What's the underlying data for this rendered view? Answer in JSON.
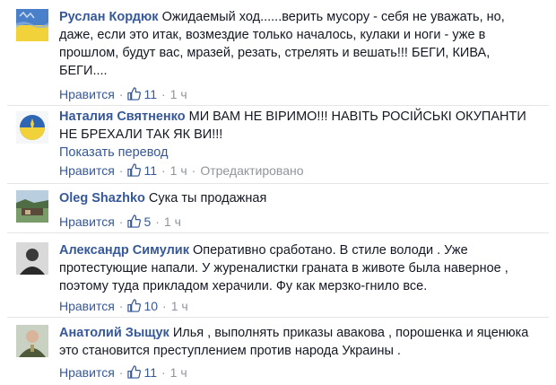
{
  "comments": [
    {
      "author": "Руслан Кордюк",
      "text": "Ожидаемый ход......верить мусору - себя не уважать, но, даже, если это итак, возмездие только началось, кулаки и ноги - уже в прошлом, будут вас, мразей, резать, стрелять и вешать!!! БЕГИ, КИВА, БЕГИ....",
      "like_label": "Нравится",
      "likes": "11",
      "time": "1 ч",
      "avatar": "ukraine-flag-avatar"
    },
    {
      "author": "Наталия Святненко",
      "text": "МИ ВАМ НЕ ВІРИМО!!! НАВІТЬ РОСІЙСЬКІ ОКУПАНТИ НЕ БРЕХАЛИ ТАК ЯК ВИ!!!",
      "translate": "Показать перевод",
      "like_label": "Нравится",
      "likes": "11",
      "time": "1 ч",
      "edited": "Отредактировано",
      "avatar": "ukraine-emblem-avatar"
    },
    {
      "author": "Oleg Shazhko",
      "text": "Сука ты продажная",
      "like_label": "Нравится",
      "likes": "5",
      "time": "1 ч",
      "avatar": "landscape-avatar"
    },
    {
      "author": "Александр Симулик",
      "text": "Оперативно сработано. В стиле володи . Уже протестующие напали. У журеналистки граната в животе была наверное , поэтому туда прикладом херачили. Фу как мерзко-гнило все.",
      "like_label": "Нравится",
      "likes": "10",
      "time": "1 ч",
      "avatar": "person-avatar"
    },
    {
      "author": "Анатолий Зыщук",
      "text": "Илья , выполнять приказы авакова , порошенка и яценюка это становится преступлением против народа Украины .",
      "like_label": "Нравится",
      "likes": "11",
      "time": "1 ч",
      "avatar": "uniform-person-avatar"
    }
  ],
  "colors": {
    "link": "#365899",
    "text": "#141823",
    "meta": "#90949c"
  }
}
